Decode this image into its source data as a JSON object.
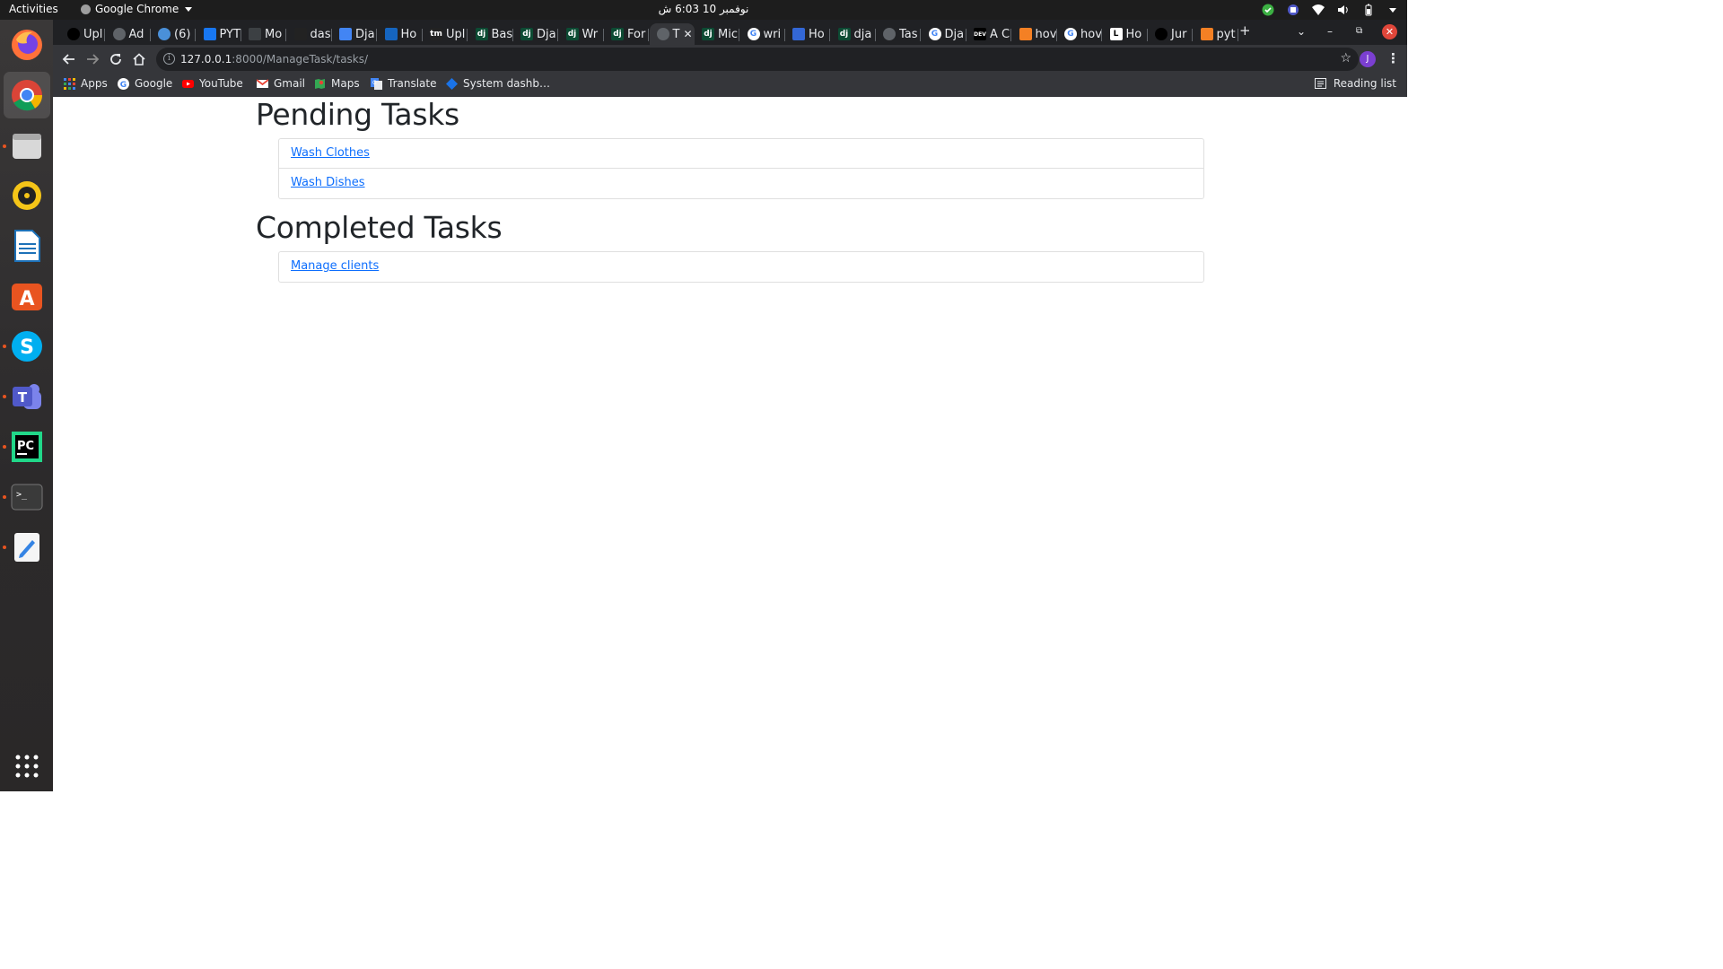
{
  "system": {
    "activities": "Activities",
    "app_menu": "Google Chrome",
    "clock": "نوفمبر 10  6:03 ش"
  },
  "dock": {
    "apps": [
      "Firefox",
      "Google Chrome",
      "Files",
      "Rhythmbox",
      "LibreOffice Writer",
      "Ubuntu Software",
      "Skype",
      "Microsoft Teams",
      "PyCharm",
      "Terminal",
      "Text Editor",
      "Show Applications"
    ]
  },
  "browser": {
    "tabs": [
      {
        "label": "Upl",
        "icon": "github-icon"
      },
      {
        "label": "Ad",
        "icon": "globe-icon"
      },
      {
        "label": "(6)",
        "icon": "chat-icon"
      },
      {
        "label": "PYT",
        "icon": "diamond-icon"
      },
      {
        "label": "Mo",
        "icon": "table-icon"
      },
      {
        "label": "das",
        "icon": "notebook-icon"
      },
      {
        "label": "Dja",
        "icon": "docs-icon"
      },
      {
        "label": "Ho",
        "icon": "cloud-icon"
      },
      {
        "label": "Upl",
        "icon": "tm-icon"
      },
      {
        "label": "Bas",
        "icon": "django-icon"
      },
      {
        "label": "Dja",
        "icon": "django-icon"
      },
      {
        "label": "Wr",
        "icon": "django-icon"
      },
      {
        "label": "For",
        "icon": "django-icon"
      },
      {
        "label": "T",
        "icon": "globe-icon"
      },
      {
        "label": "Mic",
        "icon": "django-icon"
      },
      {
        "label": "wri",
        "icon": "google-icon"
      },
      {
        "label": "Ho",
        "icon": "comment-icon"
      },
      {
        "label": "dja",
        "icon": "django-icon"
      },
      {
        "label": "Tas",
        "icon": "globe-icon"
      },
      {
        "label": "Dja",
        "icon": "google-icon"
      },
      {
        "label": "A C",
        "icon": "dev-icon"
      },
      {
        "label": "hov",
        "icon": "stackoverflow-icon"
      },
      {
        "label": "hov",
        "icon": "google-icon"
      },
      {
        "label": "Ho",
        "icon": "l-icon"
      },
      {
        "label": "Jur",
        "icon": "github-icon"
      },
      {
        "label": "pyt",
        "icon": "stackoverflow-icon"
      }
    ],
    "url_host": "127.0.0.1",
    "url_path": ":8000/ManageTask/tasks/",
    "profile_initial": "J",
    "bookmarks": [
      {
        "label": "Apps",
        "icon": "apps-grid-icon"
      },
      {
        "label": "Google",
        "icon": "google-icon"
      },
      {
        "label": "YouTube",
        "icon": "youtube-icon"
      },
      {
        "label": "Gmail",
        "icon": "gmail-icon"
      },
      {
        "label": "Maps",
        "icon": "maps-icon"
      },
      {
        "label": "Translate",
        "icon": "translate-icon"
      },
      {
        "label": "System dashb…",
        "icon": "diamond-icon"
      }
    ],
    "reading_list": "Reading list"
  },
  "page": {
    "pending_title": "Pending Tasks",
    "pending_tasks": [
      "Wash Clothes",
      "Wash Dishes"
    ],
    "completed_title": "Completed Tasks",
    "completed_tasks": [
      "Manage clients"
    ]
  },
  "colors": {
    "link": "#0d6efd",
    "accent": "#e95420"
  }
}
